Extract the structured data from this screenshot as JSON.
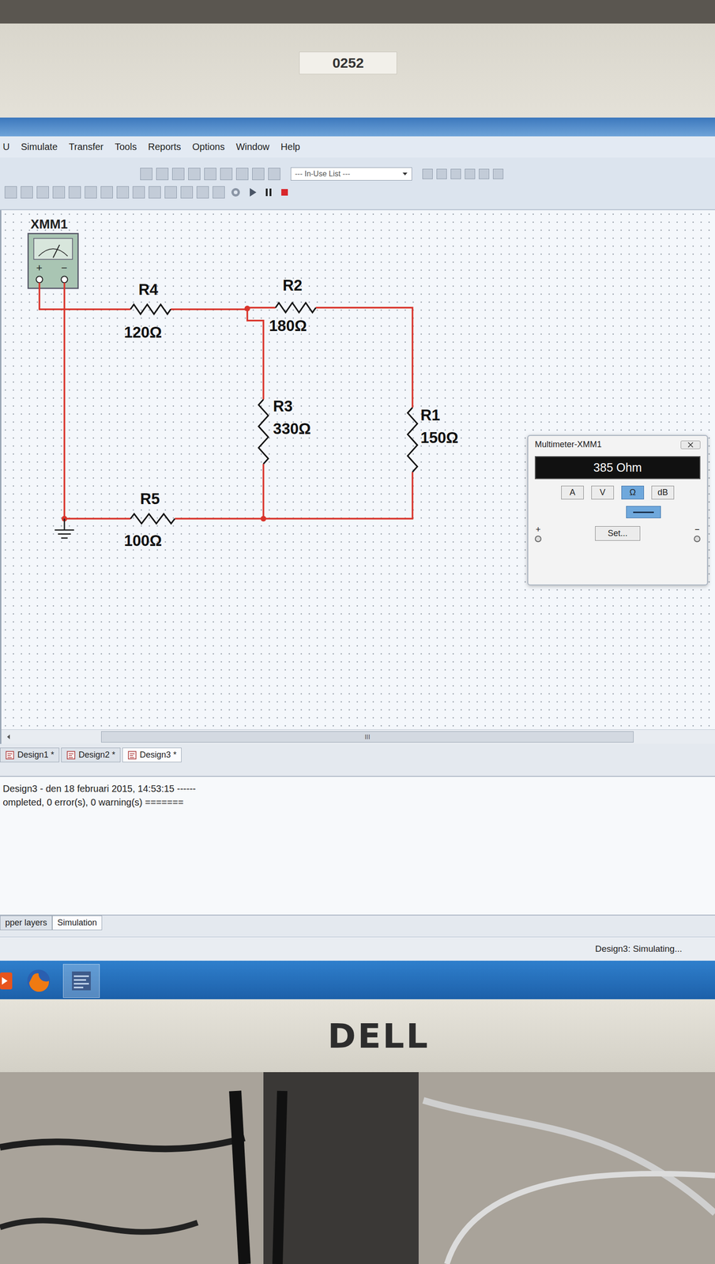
{
  "monitor": {
    "label": "0252",
    "brand": "DELL"
  },
  "menu": [
    "U",
    "Simulate",
    "Transfer",
    "Tools",
    "Reports",
    "Options",
    "Window",
    "Help"
  ],
  "toolbar": {
    "dropdown": "--- In-Use List ---"
  },
  "schematic": {
    "meter": {
      "label": "XMM1",
      "terminals": [
        "+",
        "−"
      ]
    },
    "resistors": [
      {
        "name": "R4",
        "value": "120Ω"
      },
      {
        "name": "R2",
        "value": "180Ω"
      },
      {
        "name": "R3",
        "value": "330Ω"
      },
      {
        "name": "R1",
        "value": "150Ω"
      },
      {
        "name": "R5",
        "value": "100Ω"
      }
    ]
  },
  "multimeter": {
    "title": "Multimeter-XMM1",
    "reading": "385 Ohm",
    "modes": [
      {
        "label": "A",
        "selected": false
      },
      {
        "label": "V",
        "selected": false
      },
      {
        "label": "Ω",
        "selected": true
      },
      {
        "label": "dB",
        "selected": false
      }
    ],
    "terminals": [
      "+",
      "−"
    ],
    "set_button": "Set..."
  },
  "scrollbar": {
    "grip": "III"
  },
  "design_tabs": [
    {
      "label": "Design1 *",
      "selected": false
    },
    {
      "label": "Design2 *",
      "selected": false
    },
    {
      "label": "Design3 *",
      "selected": true
    }
  ],
  "output": [
    "Design3 - den 18 februari 2015, 14:53:15 ------",
    "ompleted, 0 error(s), 0 warning(s) ======="
  ],
  "bottom_tabs": [
    {
      "label": "pper layers",
      "selected": false
    },
    {
      "label": "Simulation",
      "selected": true
    }
  ],
  "status": "Design3: Simulating..."
}
